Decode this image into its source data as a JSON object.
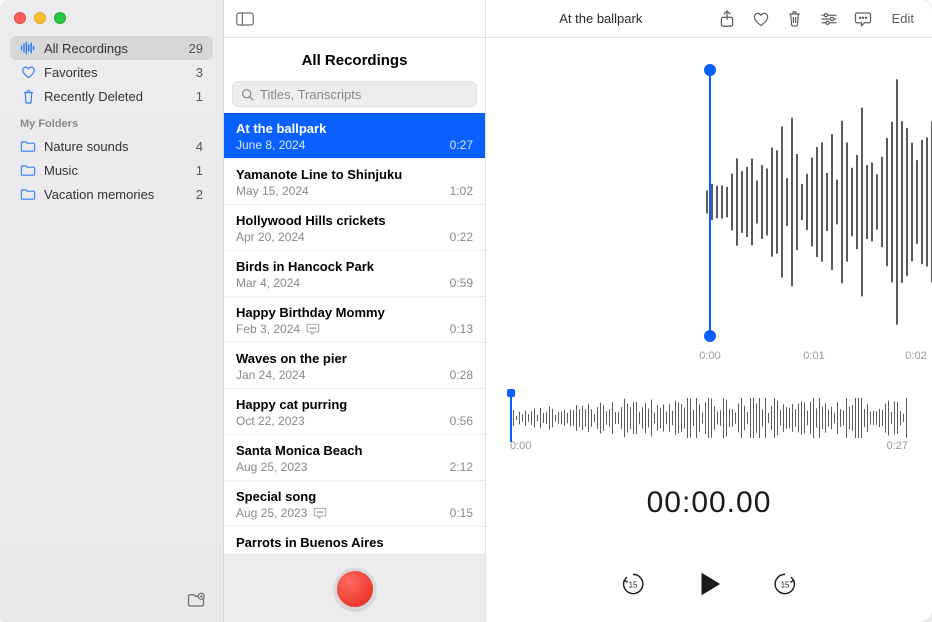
{
  "window_title": "At the ballpark",
  "sidebar": {
    "smart": [
      {
        "label": "All Recordings",
        "count": "29",
        "icon": "waveform",
        "selected": true
      },
      {
        "label": "Favorites",
        "count": "3",
        "icon": "heart",
        "selected": false
      },
      {
        "label": "Recently Deleted",
        "count": "1",
        "icon": "trash",
        "selected": false
      }
    ],
    "my_folders_heading": "My Folders",
    "folders": [
      {
        "label": "Nature sounds",
        "count": "4",
        "icon": "folder"
      },
      {
        "label": "Music",
        "count": "1",
        "icon": "folder"
      },
      {
        "label": "Vacation memories",
        "count": "2",
        "icon": "folder"
      }
    ]
  },
  "mid": {
    "title": "All Recordings",
    "search_placeholder": "Titles, Transcripts",
    "items": [
      {
        "title": "At the ballpark",
        "date": "June 8, 2024",
        "duration": "0:27",
        "selected": true,
        "transcript": false
      },
      {
        "title": "Yamanote Line to Shinjuku",
        "date": "May 15, 2024",
        "duration": "1:02",
        "selected": false,
        "transcript": false
      },
      {
        "title": "Hollywood Hills crickets",
        "date": "Apr 20, 2024",
        "duration": "0:22",
        "selected": false,
        "transcript": false
      },
      {
        "title": "Birds in Hancock Park",
        "date": "Mar 4, 2024",
        "duration": "0:59",
        "selected": false,
        "transcript": false
      },
      {
        "title": "Happy Birthday Mommy",
        "date": "Feb 3, 2024",
        "duration": "0:13",
        "selected": false,
        "transcript": true
      },
      {
        "title": "Waves on the pier",
        "date": "Jan 24, 2024",
        "duration": "0:28",
        "selected": false,
        "transcript": false
      },
      {
        "title": "Happy cat purring",
        "date": "Oct 22, 2023",
        "duration": "0:56",
        "selected": false,
        "transcript": false
      },
      {
        "title": "Santa Monica Beach",
        "date": "Aug 25, 2023",
        "duration": "2:12",
        "selected": false,
        "transcript": false
      },
      {
        "title": "Special song",
        "date": "Aug 25, 2023",
        "duration": "0:15",
        "selected": false,
        "transcript": true
      },
      {
        "title": "Parrots in Buenos Aires",
        "date": "",
        "duration": "",
        "selected": false,
        "transcript": false
      }
    ]
  },
  "detail": {
    "ruler": [
      "0:00",
      "0:01",
      "0:02"
    ],
    "scrub_start": "0:00",
    "scrub_end": "0:27",
    "timer": "00:00.00",
    "edit_label": "Edit"
  }
}
